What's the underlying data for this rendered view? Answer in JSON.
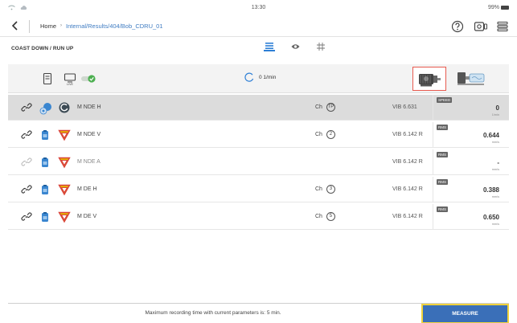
{
  "statusbar": {
    "time": "13:30",
    "battery": "99%"
  },
  "nav": {
    "home_label": "Home",
    "path_label": "Internal/Results/404/Bob_CDRU_01"
  },
  "section": {
    "title": "COAST DOWN / RUN UP"
  },
  "toolbar": {
    "rpm_value": "0 1/min"
  },
  "rows": [
    {
      "name": "M NDE H",
      "channel_label": "Ch",
      "channel": "TP",
      "device": "VIB 6.631",
      "badge": "SPEED",
      "value": "0",
      "unit": "1/min"
    },
    {
      "name": "M NDE V",
      "channel_label": "Ch",
      "channel": "2",
      "device": "VIB 6.142 R",
      "badge": "RMS",
      "value": "0.644",
      "unit": "mm/s"
    },
    {
      "name": "M NDE A",
      "channel_label": "",
      "channel": "",
      "device": "VIB 6.142 R",
      "badge": "RMS",
      "value": "-",
      "unit": "mm/s"
    },
    {
      "name": "M DE H",
      "channel_label": "Ch",
      "channel": "3",
      "device": "VIB 6.142 R",
      "badge": "RMS",
      "value": "0.388",
      "unit": "mm/s"
    },
    {
      "name": "M DE V",
      "channel_label": "Ch",
      "channel": "5",
      "device": "VIB 6.142 R",
      "badge": "RMS",
      "value": "0.650",
      "unit": "mm/s"
    }
  ],
  "footer": {
    "message": "Maximum recording time with current parameters is: 5 min.",
    "measure_label": "MEASURE"
  },
  "colors": {
    "accent_blue": "#2d7fd6",
    "measure_bg": "#3a6fb8",
    "highlight_red": "#e85a4f",
    "focus_yellow": "#f0d23c",
    "live_green": "#4caf50",
    "type_yellow": "#e6b800",
    "type_red": "#d9443a"
  }
}
